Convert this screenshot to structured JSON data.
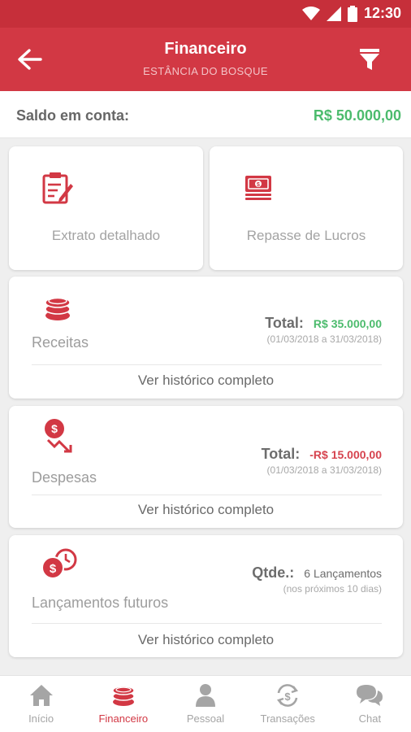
{
  "status_bar": {
    "time": "12:30"
  },
  "header": {
    "title": "Financeiro",
    "subtitle": "ESTÂNCIA DO BOSQUE",
    "back_icon": "arrow-left-icon",
    "filter_icon": "filter-icon"
  },
  "balance": {
    "label": "Saldo em conta:",
    "value": "R$ 50.000,00"
  },
  "quick_cards": [
    {
      "label": "Extrato detalhado",
      "icon": "clipboard-edit-icon"
    },
    {
      "label": "Repasse de Lucros",
      "icon": "money-stack-icon"
    }
  ],
  "summary_cards": [
    {
      "label": "Receitas",
      "total_label": "Total:",
      "amount": "R$ 35.000,00",
      "period": "(01/03/2018 a 31/03/2018)",
      "link": "Ver histórico completo",
      "icon": "coins-stack-icon"
    },
    {
      "label": "Despesas",
      "total_label": "Total:",
      "amount": "-R$ 15.000,00",
      "period": "(01/03/2018 a 31/03/2018)",
      "link": "Ver histórico completo",
      "icon": "money-down-icon"
    },
    {
      "label": "Lançamentos futuros",
      "total_label": "Qtde.:",
      "amount": "6 Lançamentos",
      "period": "(nos próximos 10 dias)",
      "link": "Ver histórico completo",
      "icon": "money-clock-icon"
    }
  ],
  "tabs": [
    {
      "label": "Início",
      "icon": "home-icon",
      "active": false
    },
    {
      "label": "Financeiro",
      "icon": "coins-icon",
      "active": true
    },
    {
      "label": "Pessoal",
      "icon": "person-icon",
      "active": false
    },
    {
      "label": "Transações",
      "icon": "transactions-icon",
      "active": false
    },
    {
      "label": "Chat",
      "icon": "chat-icon",
      "active": false
    }
  ],
  "colors": {
    "primary": "#d23844",
    "positive": "#4cbb6d",
    "negative": "#d6434e"
  }
}
